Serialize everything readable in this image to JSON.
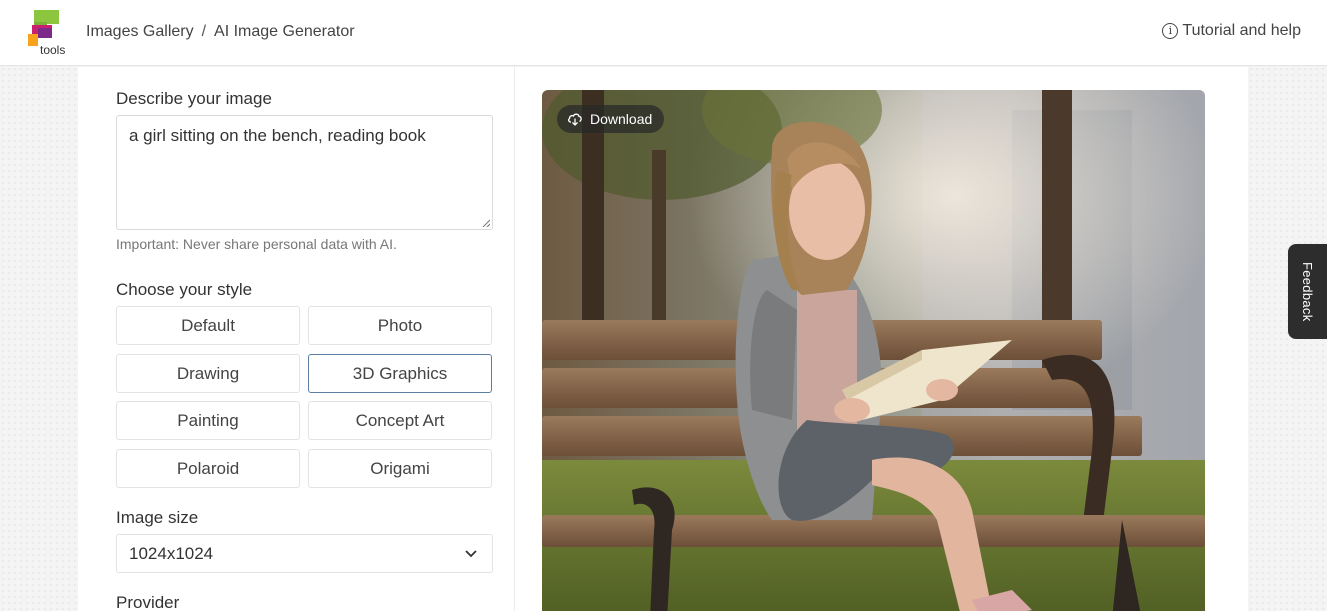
{
  "header": {
    "logo_text": "tools",
    "breadcrumb": [
      "Images Gallery",
      "AI Image Generator"
    ],
    "help_label": "Tutorial and help"
  },
  "form": {
    "describe_label": "Describe your image",
    "prompt_value": "a girl sitting on the bench, reading book",
    "hint": "Important: Never share personal data with AI.",
    "style_label": "Choose your style",
    "styles": [
      "Default",
      "Photo",
      "Drawing",
      "3D Graphics",
      "Painting",
      "Concept Art",
      "Polaroid",
      "Origami"
    ],
    "selected_style": "3D Graphics",
    "size_label": "Image size",
    "size_value": "1024x1024",
    "provider_label": "Provider"
  },
  "image": {
    "download_label": "Download"
  },
  "feedback_label": "Feedback",
  "colors": {
    "accent_border": "#5a7fa3",
    "header_bg": "#ffffff",
    "feedback_bg": "#2d2d2d"
  }
}
